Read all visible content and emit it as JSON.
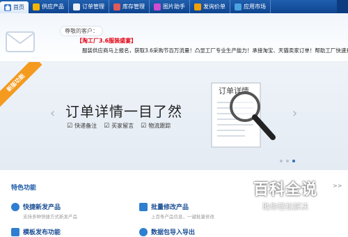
{
  "nav": {
    "tabs": [
      {
        "label": "首页",
        "icon": "home-icon"
      },
      {
        "label": "供应产品",
        "icon": "product-icon"
      },
      {
        "label": "订单管理",
        "icon": "order-icon"
      },
      {
        "label": "库存管理",
        "icon": "inventory-icon"
      },
      {
        "label": "图片助手",
        "icon": "image-icon"
      },
      {
        "label": "发询价单",
        "icon": "inquiry-icon"
      },
      {
        "label": "应用市场",
        "icon": "app-market-icon"
      }
    ]
  },
  "greeting": {
    "label": "尊敬的客户：",
    "promo_title": "【淘工厂3.6服装盛宴】",
    "promo_text": "服装供应商马上报名，获取3.6采购节百万流量！凸显工厂专业生产能力！承接淘宝、天猫卖家订单！帮助工厂快速升值！"
  },
  "banner": {
    "ribbon": "新版功能",
    "title": "订单详情一目了然",
    "features": [
      "快递备注",
      "买家留言",
      "物流跟踪"
    ],
    "doc_label": "订单详情",
    "prev": "‹",
    "next": "›"
  },
  "section": {
    "title": "特色功能",
    "more": ">>",
    "items": [
      {
        "name": "快捷新发产品",
        "desc": "支持多种快捷方式新发产品"
      },
      {
        "name": "批量修改产品",
        "desc": "上百条产品信息，一键批量修改"
      },
      {
        "name": "模板发布功能",
        "desc": ""
      },
      {
        "name": "数据包导入导出",
        "desc": ""
      }
    ]
  },
  "watermark": {
    "main": "百科全说",
    "sub": "助你轻松解决"
  },
  "colors": {
    "nav": "#1f5fae",
    "accent": "#1a5aa8",
    "promo": "#e60012",
    "ribbon": "#f39a1f"
  }
}
